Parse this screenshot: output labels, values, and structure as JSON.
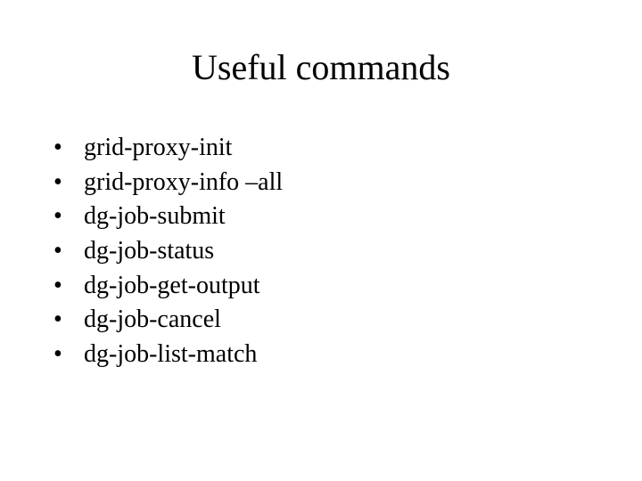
{
  "title": "Useful commands",
  "items": [
    "grid-proxy-init",
    "grid-proxy-info –all",
    "dg-job-submit",
    "dg-job-status",
    "dg-job-get-output",
    "dg-job-cancel",
    "dg-job-list-match"
  ]
}
